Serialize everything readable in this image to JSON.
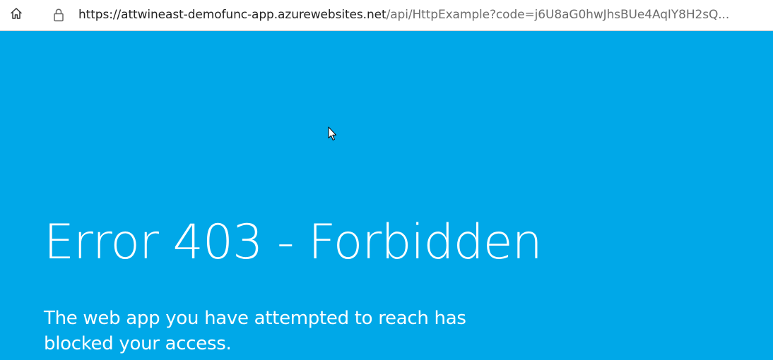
{
  "browser": {
    "home_icon": "home-icon",
    "lock_icon": "lock-icon",
    "url_host": "https://attwineast-demofunc-app.azurewebsites.net",
    "url_path": "/api/HttpExample?code=j6U8aG0hwJhsBUe4AqIY8H2sQ..."
  },
  "page": {
    "background_color": "#00a8e8",
    "title": "Error 403 - Forbidden",
    "message": "The web app you have attempted to reach has blocked your access."
  },
  "cursor_icon": "mouse-pointer-icon"
}
